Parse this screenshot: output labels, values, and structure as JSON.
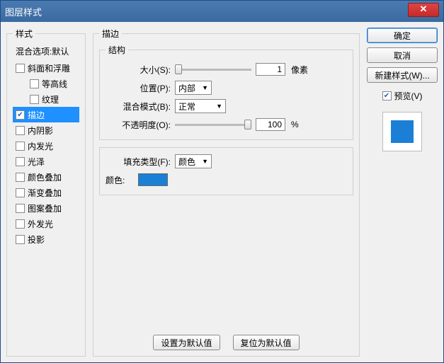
{
  "window": {
    "title": "图层样式"
  },
  "left": {
    "header": "样式",
    "blend_default": "混合选项:默认",
    "items": [
      {
        "label": "斜面和浮雕",
        "checked": false,
        "indent": false
      },
      {
        "label": "等高线",
        "checked": false,
        "indent": true
      },
      {
        "label": "纹理",
        "checked": false,
        "indent": true
      },
      {
        "label": "描边",
        "checked": true,
        "indent": false,
        "selected": true
      },
      {
        "label": "内阴影",
        "checked": false,
        "indent": false
      },
      {
        "label": "内发光",
        "checked": false,
        "indent": false
      },
      {
        "label": "光泽",
        "checked": false,
        "indent": false
      },
      {
        "label": "颜色叠加",
        "checked": false,
        "indent": false
      },
      {
        "label": "渐变叠加",
        "checked": false,
        "indent": false
      },
      {
        "label": "图案叠加",
        "checked": false,
        "indent": false
      },
      {
        "label": "外发光",
        "checked": false,
        "indent": false
      },
      {
        "label": "投影",
        "checked": false,
        "indent": false
      }
    ]
  },
  "mid": {
    "panel_title": "描边",
    "struct_title": "结构",
    "size_label": "大小(S):",
    "size_value": "1",
    "size_unit": "像素",
    "position_label": "位置(P):",
    "position_value": "内部",
    "blend_label": "混合模式(B):",
    "blend_value": "正常",
    "opacity_label": "不透明度(O):",
    "opacity_value": "100",
    "opacity_unit": "%",
    "filltype_label": "填充类型(F):",
    "filltype_value": "颜色",
    "color_label": "颜色:",
    "color_value": "#1b7fd6",
    "defaults_set": "设置为默认值",
    "defaults_reset": "复位为默认值"
  },
  "right": {
    "ok": "确定",
    "cancel": "取消",
    "new_style": "新建样式(W)...",
    "preview_label": "预览(V)",
    "preview_checked": true
  }
}
